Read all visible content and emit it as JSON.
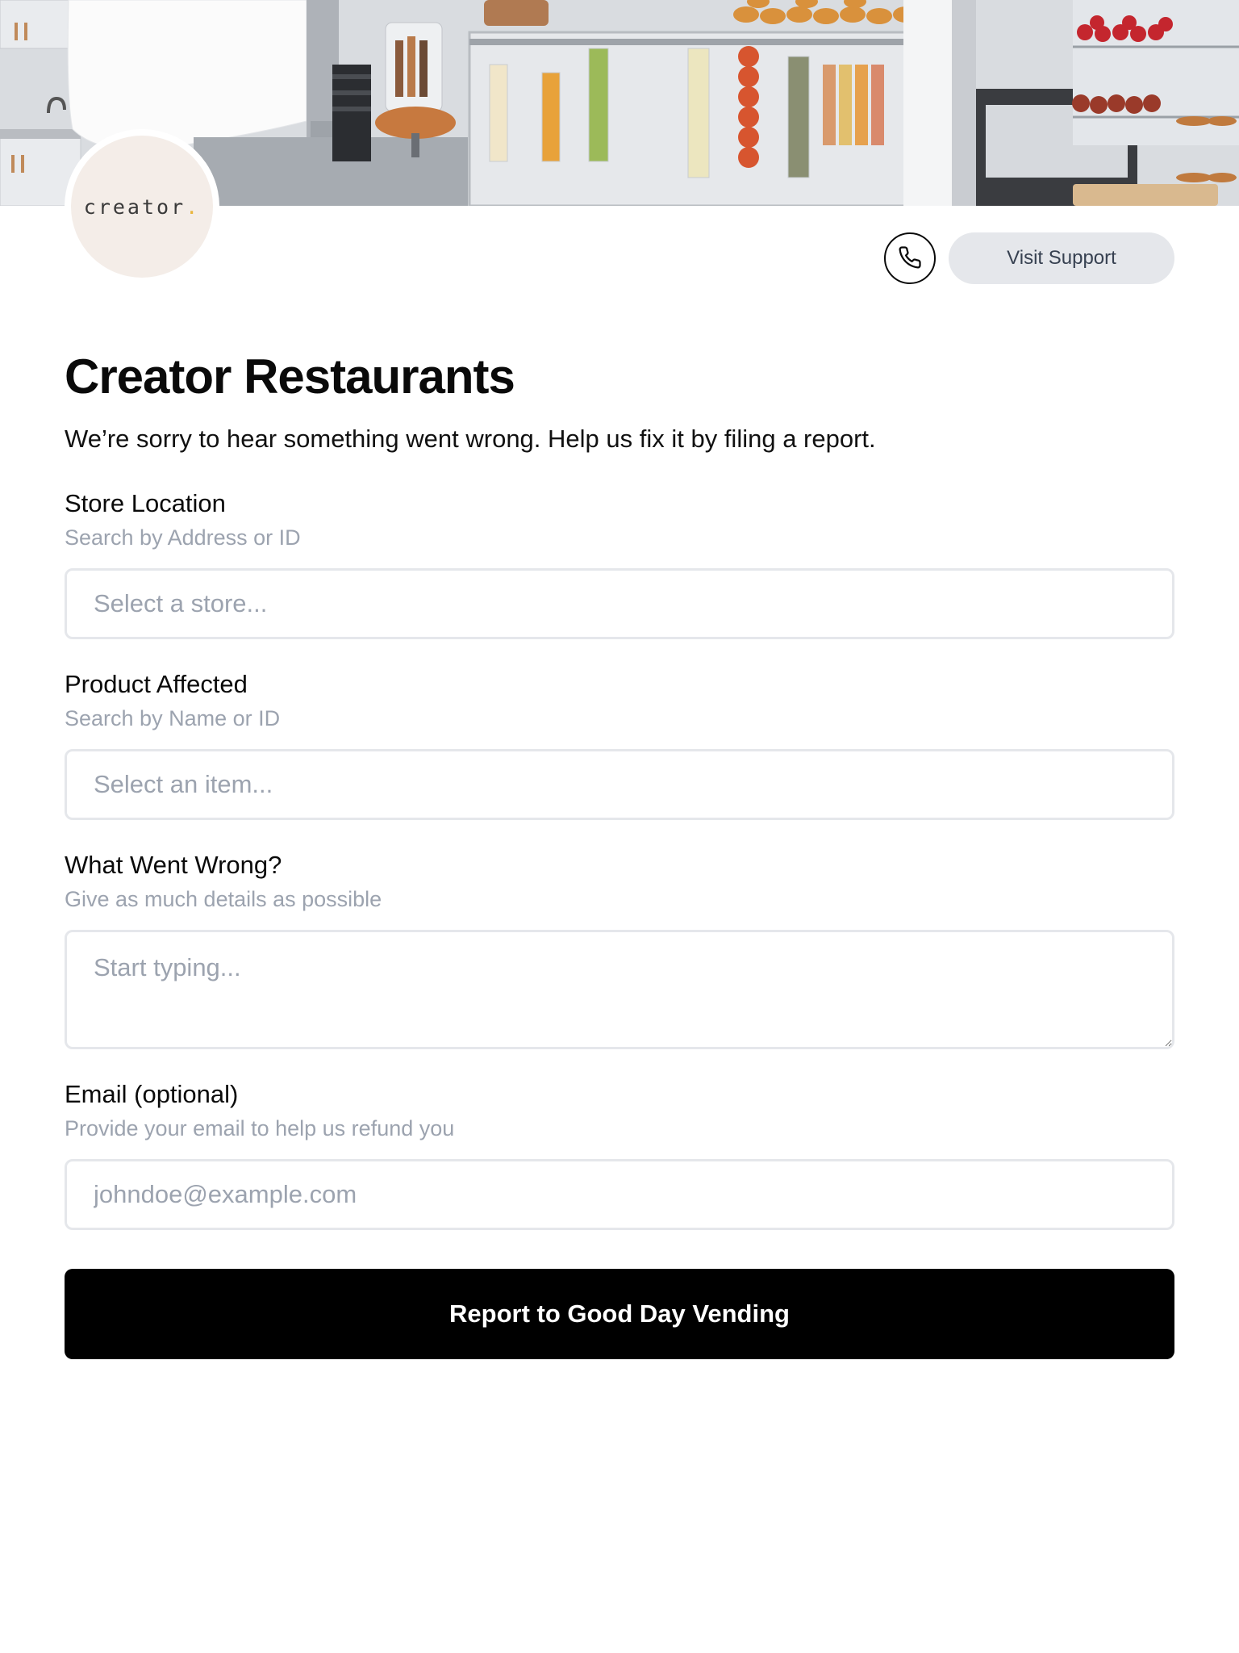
{
  "brand": {
    "logo_text": "creator",
    "logo_dot": "."
  },
  "header": {
    "phone_icon": "phone-icon",
    "support_label": "Visit Support"
  },
  "main": {
    "title": "Creator Restaurants",
    "subtitle": "We’re sorry to hear something went wrong. Help us fix it by filing a report."
  },
  "form": {
    "store": {
      "label": "Store Location",
      "hint": "Search by Address or ID",
      "placeholder": "Select a store..."
    },
    "product": {
      "label": "Product Affected",
      "hint": "Search by Name or ID",
      "placeholder": "Select an item..."
    },
    "issue": {
      "label": "What Went Wrong?",
      "hint": "Give as much details as possible",
      "placeholder": "Start typing..."
    },
    "email": {
      "label": "Email (optional)",
      "hint": "Provide your email to help us refund you",
      "placeholder": "johndoe@example.com"
    },
    "submit_label": "Report to Good Day Vending"
  },
  "colors": {
    "primary": "#000000",
    "muted_text": "#9ca3af",
    "support_bg": "#e5e7eb",
    "logo_bg": "#f4ede8"
  }
}
